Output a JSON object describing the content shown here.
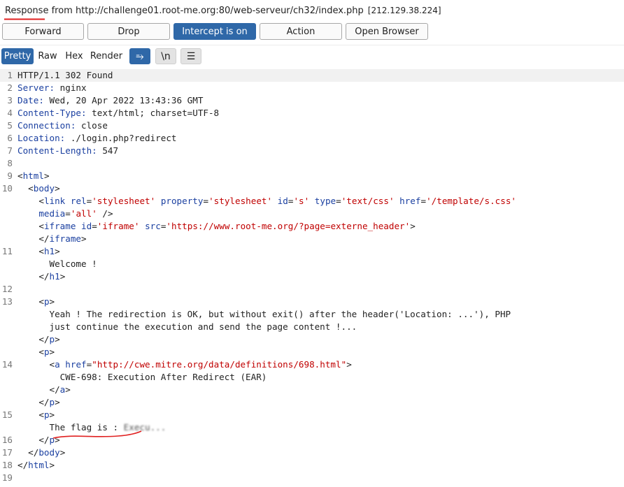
{
  "header": {
    "response_label": "Response",
    "from_text": " from http://challenge01.root-me.org:80/web-serveur/ch32/index.php",
    "ip": "[212.129.38.224]"
  },
  "buttons": {
    "forward": "Forward",
    "drop": "Drop",
    "intercept": "Intercept is on",
    "action": "Action",
    "open_browser": "Open Browser"
  },
  "tabs": {
    "pretty": "Pretty",
    "raw": "Raw",
    "hex": "Hex",
    "render": "Render",
    "wrap_icon": "⥱",
    "newline_icon": "\\n",
    "menu_icon": "☰"
  },
  "response": {
    "status": "HTTP/1.1 302 Found",
    "headers": [
      {
        "name": "Server",
        "value": "nginx"
      },
      {
        "name": "Date",
        "value": "Wed, 20 Apr 2022 13:43:36 GMT"
      },
      {
        "name": "Content-Type",
        "value": "text/html; charset=UTF-8"
      },
      {
        "name": "Connection",
        "value": "close"
      },
      {
        "name": "Location",
        "value": "./login.php?redirect"
      },
      {
        "name": "Content-Length",
        "value": "547"
      }
    ],
    "body": {
      "link_href": "/template/s.css",
      "iframe_src": "https://www.root-me.org/?page=externe_header",
      "h1_text": "Welcome !",
      "p1_line1": "Yeah ! The redirection is OK, but without exit() after the header('Location: ...'), PHP",
      "p1_line2": "just continue the execution and send the page content !...",
      "a_href": "http://cwe.mitre.org/data/definitions/698.html",
      "a_text": "CWE-698: Execution After Redirect (EAR)",
      "flag_label": "The flag is : ",
      "flag_value": "Execu..."
    }
  },
  "line_numbers": [
    "1",
    "2",
    "3",
    "4",
    "5",
    "6",
    "7",
    "8",
    "9",
    "10",
    "",
    "",
    "",
    "11",
    "",
    "",
    "12",
    "13",
    "",
    "",
    "",
    "14",
    "",
    "",
    "",
    "15",
    "",
    "16",
    "17",
    "18",
    "19"
  ],
  "colors": {
    "accent": "#2f68a8",
    "header_key": "#1a3fa0",
    "attr_value": "#c00000",
    "annotation": "#e02020"
  }
}
